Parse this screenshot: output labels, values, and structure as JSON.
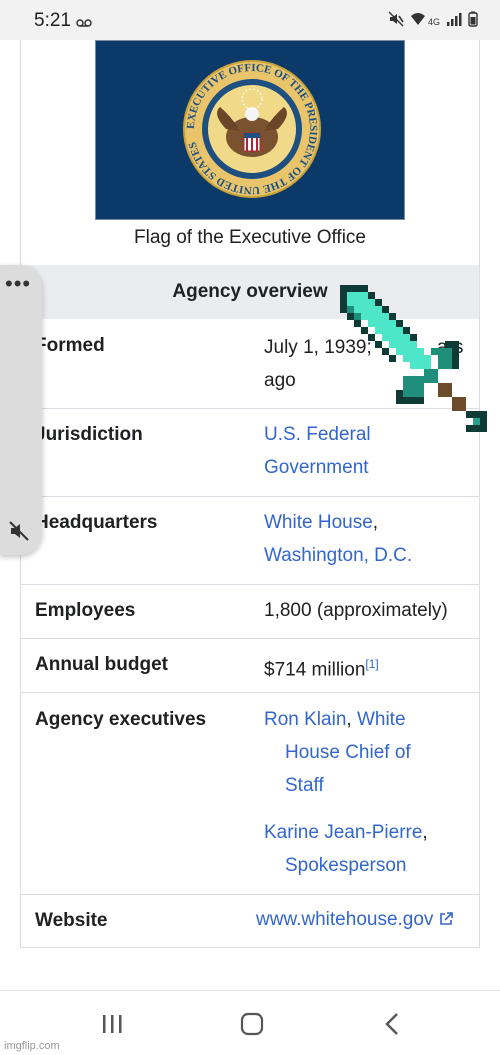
{
  "status_bar": {
    "time": "5:21",
    "network": "4G"
  },
  "infobox": {
    "flag_caption": "Flag of the Executive Office",
    "seal_text": "EXECUTIVE OFFICE OF THE PRESIDENT OF THE UNITED STATES",
    "section_header": "Agency overview",
    "rows": {
      "formed": {
        "label": "Formed",
        "value": "July 1, 1939;",
        "value_cont": "ars",
        "value_line2": "ago"
      },
      "jurisdiction": {
        "label": "Jurisdiction",
        "link1": "U.S. Federal",
        "link2": "Government"
      },
      "headquarters": {
        "label": "Headquarters",
        "link1": "White House",
        "sep": ",",
        "link2": "Washington, D.C."
      },
      "employees": {
        "label": "Employees",
        "value": "1,800 (approximately)"
      },
      "budget": {
        "label": "Annual budget",
        "value": "$714 million",
        "ref": "[1]"
      },
      "executives": {
        "label": "Agency executives",
        "exec1_name": "Ron Klain",
        "exec1_role_a": "White",
        "exec1_role_b": "House Chief of",
        "exec1_role_c": "Staff",
        "exec2_name": "Karine Jean-Pierre",
        "exec2_role": "Spokesperson",
        "comma": ","
      },
      "website": {
        "label": "Website",
        "value": "www.whitehouse.gov"
      }
    }
  },
  "watermark": "imgflip.com",
  "colors": {
    "link": "#3366cc",
    "flag_bg": "#0b3a68",
    "header_bg": "#eaecf0",
    "sword": "#4ee6c8"
  }
}
